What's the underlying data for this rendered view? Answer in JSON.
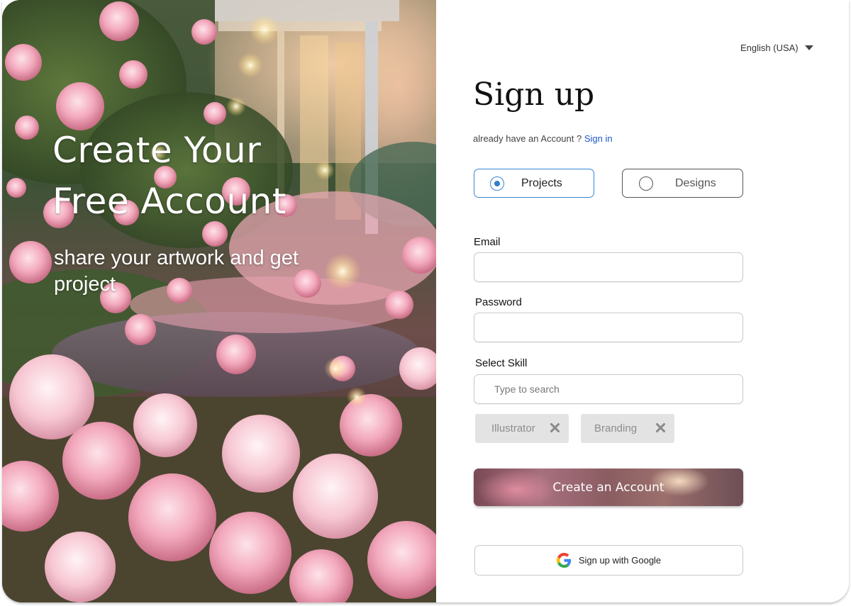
{
  "hero": {
    "title_line1": "Create Your",
    "title_line2": "Free Account",
    "subtitle": "share your artwork and get project"
  },
  "language": {
    "label": "English (USA)"
  },
  "form": {
    "title": "Sign up",
    "account_prompt": "already have an Account ?",
    "signin_link": "Sign in",
    "account_types": [
      {
        "label": "Projects",
        "selected": true
      },
      {
        "label": "Designs",
        "selected": false
      }
    ],
    "email": {
      "label": "Email",
      "value": "",
      "placeholder": ""
    },
    "password": {
      "label": "Password",
      "value": "",
      "placeholder": ""
    },
    "skill": {
      "label": "Select Skill",
      "placeholder": "Type to search"
    },
    "selected_skills": [
      "Illustrator",
      "Branding"
    ],
    "create_button": "Create an Account",
    "google_button": "Sign up with Google"
  },
  "colors": {
    "radio_selected": "#3a86d4",
    "link": "#1e57c6",
    "chip_bg": "#e3e3e3"
  },
  "icons": [
    "chevron-down-icon",
    "remove-icon",
    "google-icon"
  ]
}
